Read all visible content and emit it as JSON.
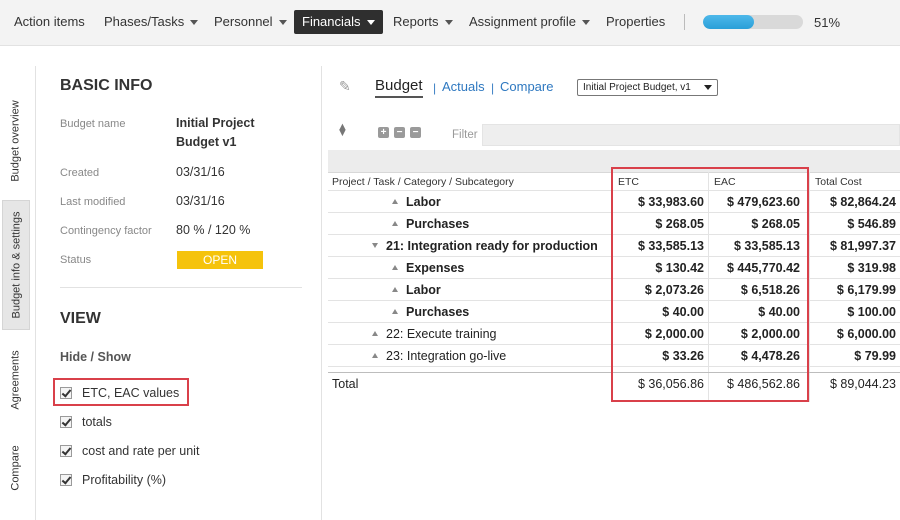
{
  "nav": {
    "items": [
      {
        "label": "Action items",
        "has_caret": false
      },
      {
        "label": "Phases/Tasks",
        "has_caret": true
      },
      {
        "label": "Personnel",
        "has_caret": true
      },
      {
        "label": "Financials",
        "has_caret": true,
        "active": true
      },
      {
        "label": "Reports",
        "has_caret": true
      },
      {
        "label": "Assignment profile",
        "has_caret": true
      },
      {
        "label": "Properties",
        "has_caret": false
      }
    ],
    "progress_percent": 51,
    "progress_label": "51%",
    "progress_color": "#2a9fd8"
  },
  "side_tabs": [
    {
      "label": "Budget overview",
      "active": false
    },
    {
      "label": "Budget info & settings",
      "active": true
    },
    {
      "label": "Agreements",
      "active": false
    },
    {
      "label": "Compare",
      "active": false
    }
  ],
  "basic_info": {
    "title": "BASIC INFO",
    "budget_name_label": "Budget name",
    "budget_name_value": "Initial Project Budget v1",
    "created_label": "Created",
    "created_value": "03/31/16",
    "last_modified_label": "Last modified",
    "last_modified_value": "03/31/16",
    "contingency_label": "Contingency factor",
    "contingency_value": "80 % / 120 %",
    "status_label": "Status",
    "status_value": "OPEN",
    "status_color": "#f5c30c"
  },
  "view": {
    "title": "VIEW",
    "hide_show_label": "Hide / Show",
    "options": [
      {
        "label": "ETC, EAC values",
        "checked": true
      },
      {
        "label": "totals",
        "checked": true
      },
      {
        "label": "cost and rate per unit",
        "checked": true
      },
      {
        "label": "Profitability (%)",
        "checked": true
      }
    ]
  },
  "budget": {
    "tabs": {
      "budget": "Budget",
      "actuals": "Actuals",
      "compare": "Compare",
      "separator": "|"
    },
    "selected_budget": "Initial Project Budget, v1",
    "filter_label": "Filter",
    "columns": {
      "name": "Project / Task / Category / Subcategory",
      "etc": "ETC",
      "eac": "EAC",
      "total": "Total Cost"
    },
    "rows": [
      {
        "name": "Labor",
        "indent": 2,
        "toggle": "up",
        "bold": true,
        "etc": "$ 33,983.60",
        "eac": "$ 479,623.60",
        "total": "$ 82,864.24"
      },
      {
        "name": "Purchases",
        "indent": 2,
        "toggle": "up",
        "bold": true,
        "etc": "$ 268.05",
        "eac": "$ 268.05",
        "total": "$ 546.89"
      },
      {
        "name": "21: Integration ready for production",
        "indent": 1,
        "toggle": "down",
        "bold": true,
        "etc": "$ 33,585.13",
        "eac": "$ 33,585.13",
        "total": "$ 81,997.37"
      },
      {
        "name": "Expenses",
        "indent": 2,
        "toggle": "up",
        "bold": true,
        "etc": "$ 130.42",
        "eac": "$ 445,770.42",
        "total": "$ 319.98"
      },
      {
        "name": "Labor",
        "indent": 2,
        "toggle": "up",
        "bold": true,
        "etc": "$ 2,073.26",
        "eac": "$ 6,518.26",
        "total": "$ 6,179.99"
      },
      {
        "name": "Purchases",
        "indent": 2,
        "toggle": "up",
        "bold": true,
        "etc": "$ 40.00",
        "eac": "$ 40.00",
        "total": "$ 100.00"
      },
      {
        "name": "22: Execute training",
        "indent": 1,
        "toggle": "up",
        "bold": false,
        "etc": "$ 2,000.00",
        "eac": "$ 2,000.00",
        "total": "$ 6,000.00"
      },
      {
        "name": "23: Integration go-live",
        "indent": 1,
        "toggle": "up",
        "bold": false,
        "etc": "$ 33.26",
        "eac": "$ 4,478.26",
        "total": "$ 79.99"
      }
    ],
    "total_row": {
      "label": "Total",
      "etc": "$ 36,056.86",
      "eac": "$ 486,562.86",
      "total": "$ 89,044.23"
    }
  },
  "highlight_color": "#d9404a"
}
